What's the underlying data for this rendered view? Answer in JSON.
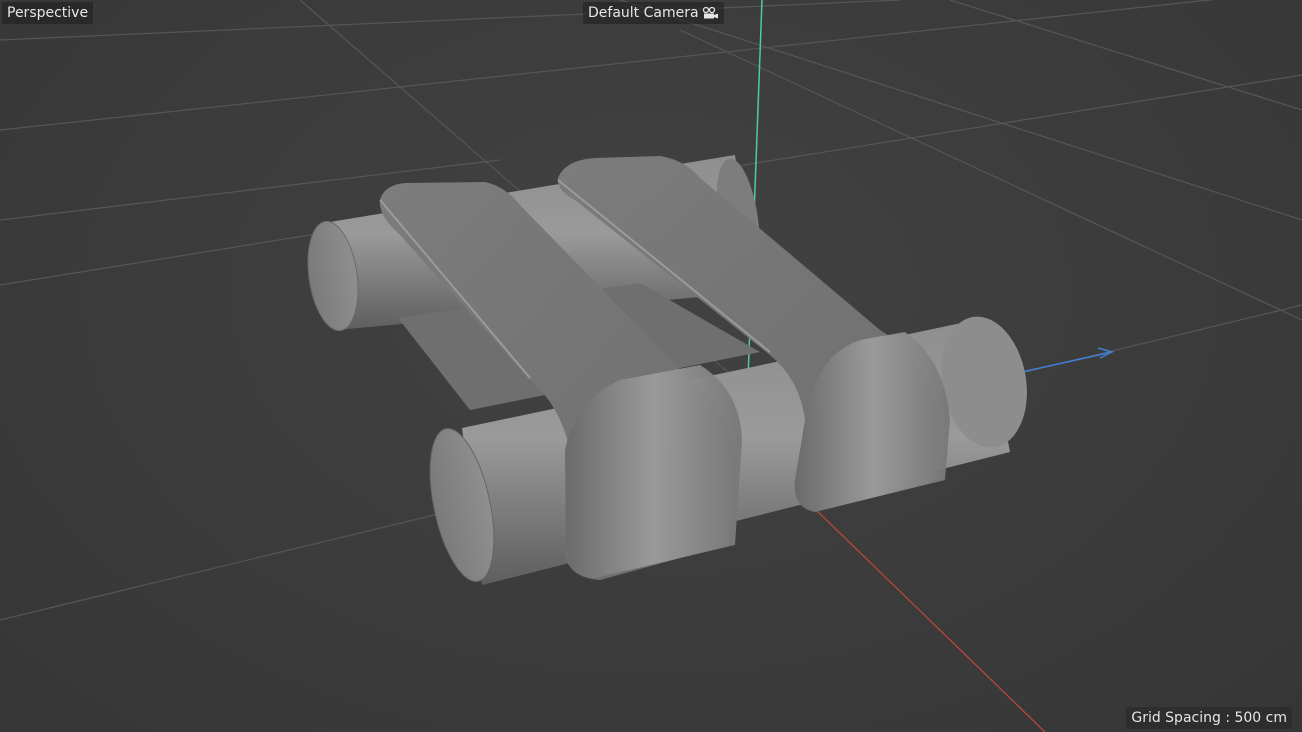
{
  "viewport": {
    "view_mode": "Perspective",
    "camera": "Default Camera",
    "camera_icon": "camera-icon",
    "grid_spacing": "Grid Spacing : 500 cm"
  },
  "colors": {
    "background": "#3d3d3d",
    "grid_line": "#5a5a5a",
    "axis_x": "#c2483c",
    "axis_y": "#4fc9a8",
    "axis_z": "#3f7fd6",
    "object_base": "#808080"
  }
}
